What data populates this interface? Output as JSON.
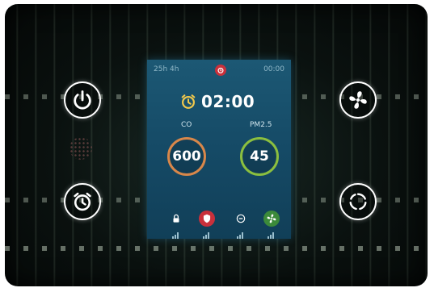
{
  "status": {
    "left_text": "25h 4h",
    "right_text": "00:00"
  },
  "timer": {
    "time": "02:00"
  },
  "sensors": {
    "co2": {
      "label": "CO",
      "value": "600"
    },
    "pm25": {
      "label": "PM2.5",
      "value": "45"
    }
  },
  "icons": {
    "power": "power-icon",
    "timer": "alarm-clock-icon",
    "fan": "fan-icon",
    "mode": "cycle-mode-icon",
    "lock": "lock-icon",
    "shield": "shield-icon",
    "minus": "minus-circle-icon",
    "fan_small": "fan-icon"
  },
  "colors": {
    "screen": "#1c5874",
    "co2_ring": "#d8874a",
    "pm_ring": "#8bbf3f",
    "alert_red": "#c9303b",
    "fan_green": "#3c8a3a"
  }
}
